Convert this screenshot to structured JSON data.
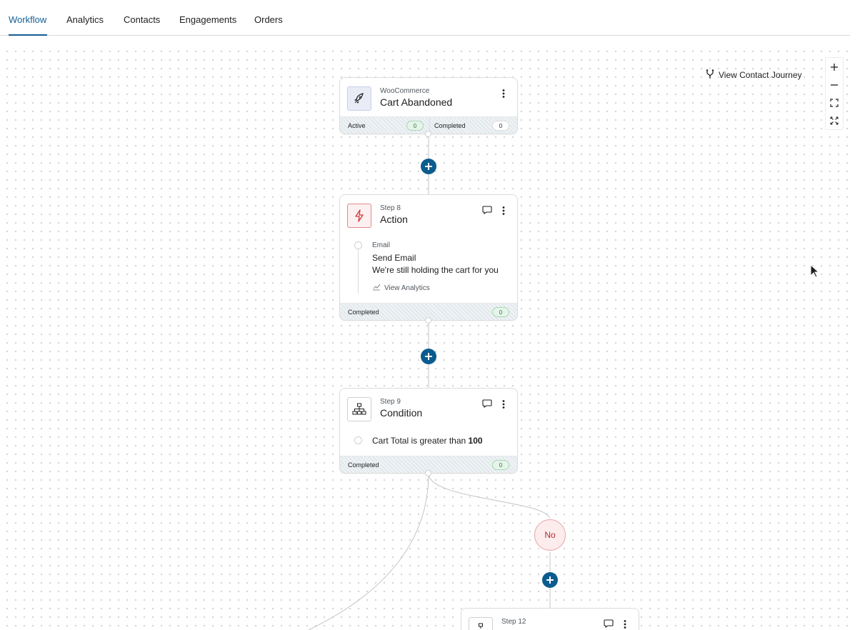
{
  "tabs": [
    {
      "label": "Workflow",
      "active": true
    },
    {
      "label": "Analytics",
      "active": false
    },
    {
      "label": "Contacts",
      "active": false
    },
    {
      "label": "Engagements",
      "active": false
    },
    {
      "label": "Orders",
      "active": false
    }
  ],
  "toolbar": {
    "journey_label": "View Contact Journey",
    "zoom_controls": [
      "zoom-in",
      "zoom-out",
      "fit-view",
      "fullscreen"
    ]
  },
  "trigger": {
    "source": "WooCommerce",
    "title": "Cart Abandoned",
    "active_label": "Active",
    "active_count": "0",
    "completed_label": "Completed",
    "completed_count": "0",
    "icon": "rocket-icon"
  },
  "action_step": {
    "step": "Step 8",
    "title": "Action",
    "item_type": "Email",
    "item_name": "Send Email",
    "item_subject": "We're still holding the cart for you",
    "analytics_label": "View Analytics",
    "completed_label": "Completed",
    "completed_count": "0",
    "icon": "lightning-icon"
  },
  "condition_step": {
    "step": "Step 9",
    "title": "Condition",
    "rule_text": "Cart Total is greater than ",
    "rule_value": "100",
    "completed_label": "Completed",
    "completed_count": "0",
    "icon": "branch-icon"
  },
  "branch": {
    "no_label": "No"
  },
  "next_step": {
    "step": "Step 12"
  },
  "colors": {
    "accent": "#135e96",
    "add_button": "#0a5c8f",
    "completed_pill": "#e6f4ea",
    "no_badge": "#fcecec"
  }
}
